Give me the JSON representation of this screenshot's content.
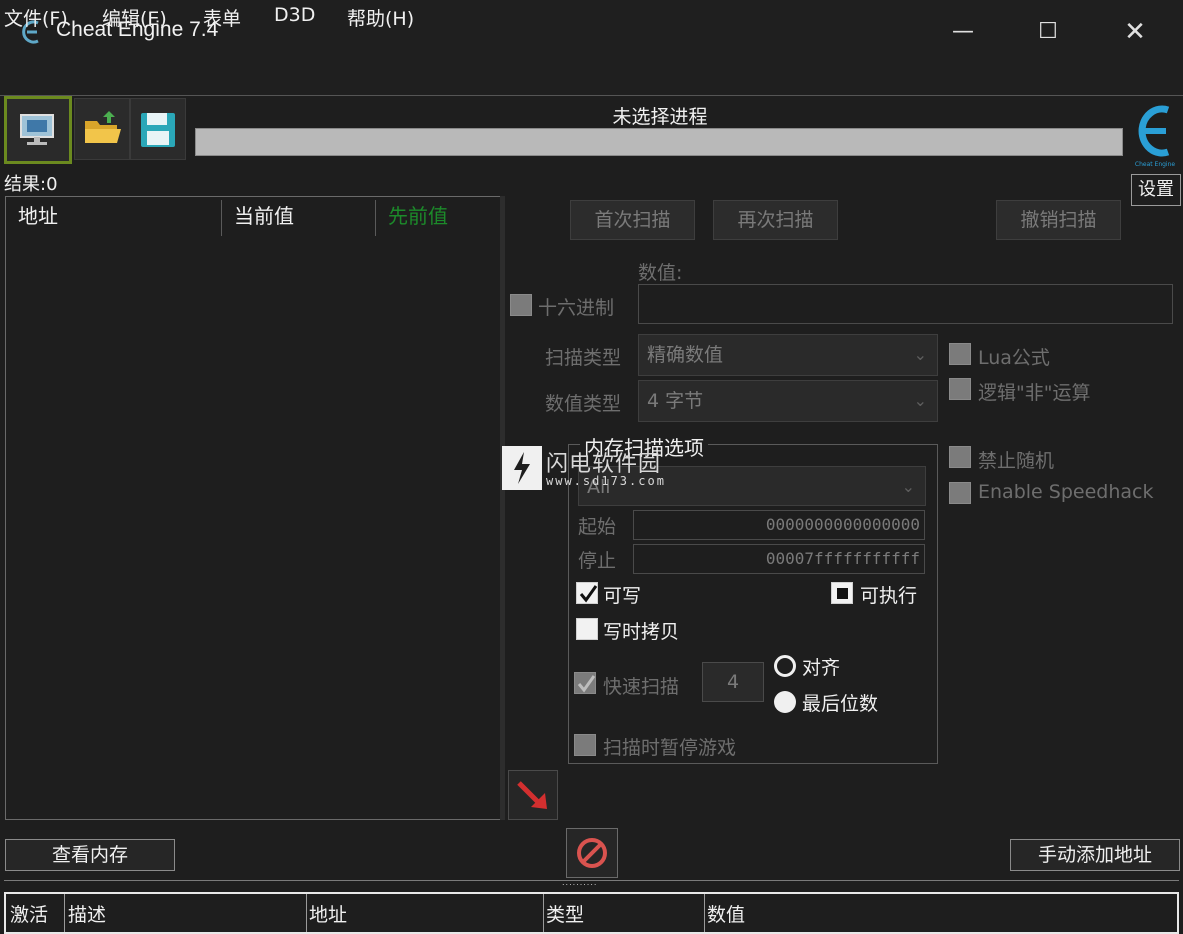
{
  "window": {
    "title": "Cheat Engine 7.4",
    "minimize": "—",
    "maximize": "☐",
    "close": "✕"
  },
  "menu": [
    "文件(F)",
    "编辑(E)",
    "表单",
    "D3D",
    "帮助(H)"
  ],
  "process": {
    "label": "未选择进程"
  },
  "settings_label": "设置",
  "results_label": "结果:0",
  "address_list": {
    "columns": [
      "地址",
      "当前值",
      "先前值"
    ],
    "previous_color": "#1c8a2a"
  },
  "scan": {
    "first_scan": "首次扫描",
    "next_scan": "再次扫描",
    "undo_scan": "撤销扫描",
    "value_label": "数值:",
    "hex_label": "十六进制",
    "scan_type_label": "扫描类型",
    "scan_type_value": "精确数值",
    "value_type_label": "数值类型",
    "value_type_value": "4 字节",
    "lua_formula": "Lua公式",
    "not_operation": "逻辑\"非\"运算",
    "no_random": "禁止随机",
    "speedhack": "Enable Speedhack"
  },
  "memory_options": {
    "title": "内存扫描选项",
    "region": "All",
    "start_label": "起始",
    "start_value": "0000000000000000",
    "stop_label": "停止",
    "stop_value": "00007fffffffffff",
    "writable": "可写",
    "executable": "可执行",
    "copy_on_write": "写时拷贝",
    "fast_scan": "快速扫描",
    "fast_scan_value": "4",
    "alignment": "对齐",
    "last_digits": "最后位数",
    "pause_game": "扫描时暂停游戏"
  },
  "view_memory": "查看内存",
  "add_address": "手动添加地址",
  "cheat_table": {
    "columns": [
      "激活",
      "描述",
      "地址",
      "类型",
      "数值"
    ]
  },
  "watermark": {
    "name": "闪电软件园",
    "url": "www.sd173.com"
  },
  "logo_caption": "Cheat Engine"
}
